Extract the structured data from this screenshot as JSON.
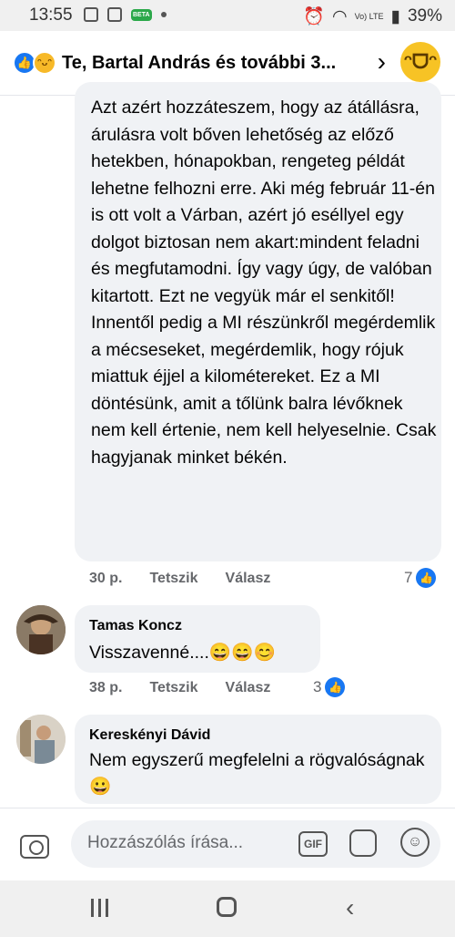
{
  "status_bar": {
    "time": "13:55",
    "battery": "39%",
    "network": "Vo) LTE",
    "beta_label": "BETA"
  },
  "header": {
    "title": "Te, Bartal András és további 3..."
  },
  "comments": [
    {
      "text": "Azt azért hozzáteszem, hogy az átállásra, árulásra volt bőven lehetőség az előző hetekben, hónapokban, rengeteg példát lehetne felhozni erre. Aki még február 11-én is ott volt a Várban, azért jó eséllyel egy dolgot biztosan nem akart:mindent feladni és megfutamodni. Így vagy úgy, de valóban kitartott. Ezt ne vegyük már el senkitől! Innentől pedig a MI részünkről megérdemlik a mécseseket, megérdemlik, hogy rójuk miattuk éjjel a kilométereket. Ez a MI döntésünk, amit a tőlünk balra lévőknek nem kell értenie, nem kell helyeselnie. Csak hagyjanak minket békén.",
      "time": "30 p.",
      "like": "Tetszik",
      "reply": "Válasz",
      "reactions": "7"
    },
    {
      "author": "Tamas Koncz",
      "text": "Visszavenné....😄😄😊",
      "time": "38 p.",
      "like": "Tetszik",
      "reply": "Válasz",
      "reactions": "3"
    },
    {
      "author": "Kereskényi Dávid",
      "text": "Nem egyszerű megfelelni a rögvalóságnak😀"
    }
  ],
  "composer": {
    "placeholder": "Hozzászólás írása...",
    "gif_label": "GIF"
  }
}
